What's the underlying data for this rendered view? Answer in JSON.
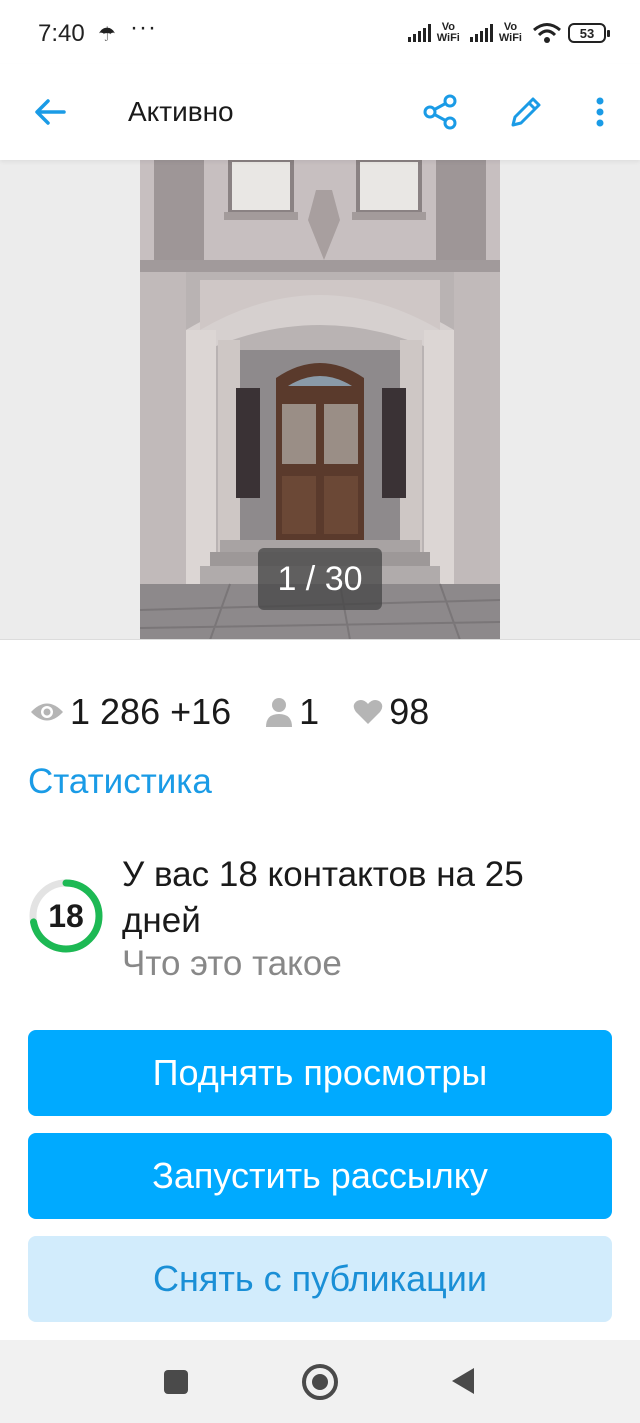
{
  "status_bar": {
    "time": "7:40",
    "umbrella_icon": "☂",
    "dots": "···",
    "vowifi_top": "Vo",
    "vowifi_bottom": "WiFi",
    "battery": "53"
  },
  "app_bar": {
    "title": "Активно",
    "icons": [
      "arrow-back-icon",
      "share-icon",
      "edit-pencil-icon",
      "more-vertical-icon"
    ]
  },
  "gallery": {
    "counter": "1 / 30"
  },
  "stats": {
    "views": "1 286 +16",
    "contacts": "1",
    "favorites": "98",
    "link": "Статистика"
  },
  "contacts_block": {
    "count": "18",
    "text": "У вас 18 контактов на 25 дней",
    "help_link": "Что это такое",
    "ring_progress": 0.72
  },
  "actions": {
    "raise_views": "Поднять просмотры",
    "start_mailing": "Запустить рассылку",
    "unpublish": "Снять с публикации"
  },
  "colors": {
    "accent": "#00aaff",
    "link": "#1a9be6",
    "secondary_bg": "#d2ecfc",
    "ring_green": "#1db954"
  }
}
